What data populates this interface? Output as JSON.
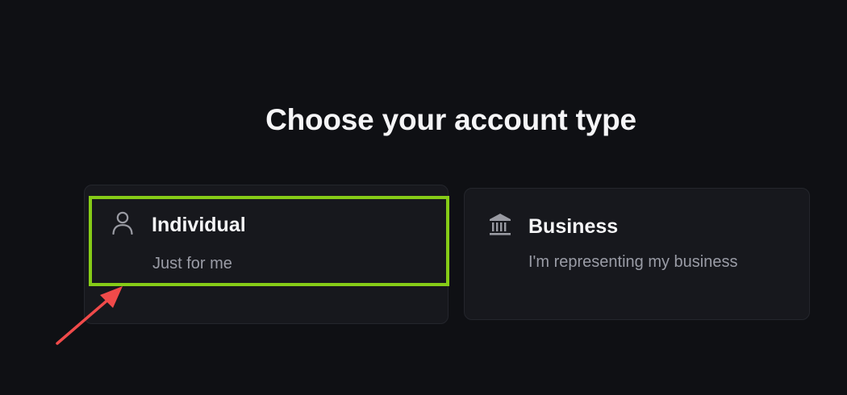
{
  "page": {
    "heading": "Choose your account type"
  },
  "options": [
    {
      "title": "Individual",
      "subtitle": "Just for me",
      "icon": "person-icon",
      "highlighted": true
    },
    {
      "title": "Business",
      "subtitle": "I'm representing my business",
      "icon": "bank-icon",
      "highlighted": false
    }
  ],
  "annotation": {
    "highlight_color": "#86cc17",
    "arrow_color": "#f04a4a",
    "arrow_icon": "arrow-pointer-icon"
  },
  "colors": {
    "background": "#0f1014",
    "card_background": "#17181d",
    "text_primary": "#f5f5f7",
    "text_secondary": "#9a9ca6"
  }
}
